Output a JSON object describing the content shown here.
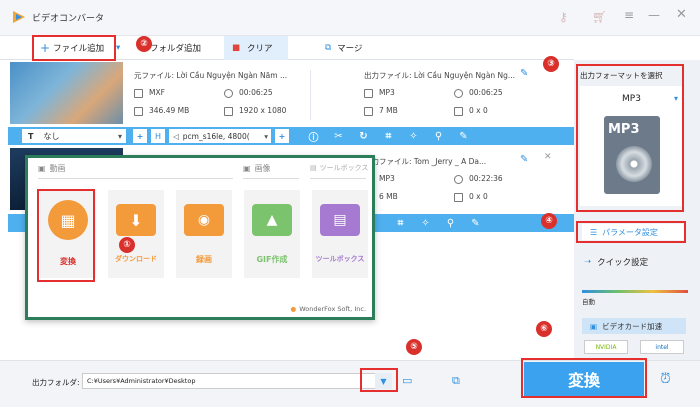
{
  "window": {
    "title": "ビデオコンバータ"
  },
  "toolbar": {
    "add_file": "ファイル追加",
    "add_folder": "フォルダ追加",
    "clear": "クリア",
    "merge": "マージ"
  },
  "files": [
    {
      "source_label": "元ファイル:",
      "source_name": "Lời Cầu Nguyện Ngàn Năm ...",
      "output_label": "出力ファイル:",
      "output_name": "Lời Cầu Nguyện Ngàn Ng...",
      "src_format": "MXF",
      "src_duration": "00:06:25",
      "src_size": "346.49 MB",
      "src_resolution": "1920 x 1080",
      "out_format": "MP3",
      "out_duration": "00:06:25",
      "out_size": "7 MB",
      "out_resolution": "0 x 0"
    },
    {
      "output_label": "出力ファイル:",
      "output_name": "Tom _Jerry _ A Da...",
      "out_format": "MP3",
      "out_duration": "00:22:36",
      "out_size": "6 MB",
      "out_resolution": "0 x 0"
    }
  ],
  "edit_bar": {
    "subtitle": "なし",
    "audio_track": "pcm_s16le, 4800("
  },
  "popup": {
    "tab_video": "動画",
    "tab_image": "画像",
    "tab_toolbox": "ツールボックス",
    "tiles": [
      "変換",
      "ダウンロード",
      "録画",
      "GIF作成",
      "ツールボックス"
    ],
    "footer": "WonderFox Soft, Inc."
  },
  "right_panel": {
    "header": "出力フォーマットを選択",
    "format": "MP3",
    "format_icon_label": "MP3",
    "params_button": "パラメータ設定",
    "quick_settings": "クイック設定",
    "slider_label": "自動",
    "gpu_button": "ビデオカード加速",
    "nvidia": "NVIDIA",
    "intel": "intel"
  },
  "bottom": {
    "output_folder_label": "出力フォルダ:",
    "output_path": "C:¥Users¥Administrator¥Desktop",
    "convert_button": "変換"
  },
  "markers": [
    "①",
    "②",
    "③",
    "④",
    "⑤",
    "⑥"
  ],
  "colors": {
    "accent": "#4fb0f0",
    "highlight": "#e52e2e",
    "orange": "#f39a3b",
    "green_border": "#2c7e5a"
  }
}
